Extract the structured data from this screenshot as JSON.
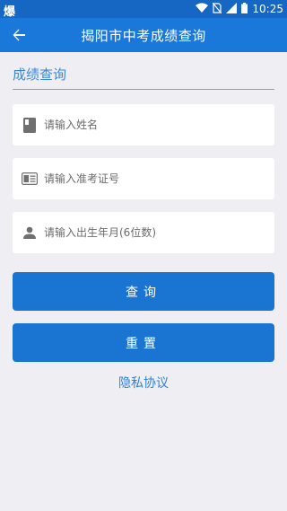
{
  "status_bar": {
    "left_glyph": "爆",
    "time": "10:25",
    "icons": [
      "wifi-icon",
      "no-sim-icon",
      "signal-icon",
      "battery-icon"
    ]
  },
  "app_bar": {
    "title": "揭阳市中考成绩查询",
    "back_icon": "arrow-left-icon"
  },
  "section": {
    "title": "成绩查询"
  },
  "form": {
    "name_placeholder": "请输入姓名",
    "ticket_placeholder": "请输入准考证号",
    "birth_placeholder": "请输入出生年月(6位数)",
    "name_value": "",
    "ticket_value": "",
    "birth_value": ""
  },
  "buttons": {
    "query": "查询",
    "reset": "重置"
  },
  "links": {
    "privacy": "隐私协议"
  },
  "colors": {
    "status_bar": "#1567c3",
    "app_bar": "#1978d9",
    "button": "#1a75d2",
    "background": "#efeef2",
    "link": "#2f83d6"
  }
}
